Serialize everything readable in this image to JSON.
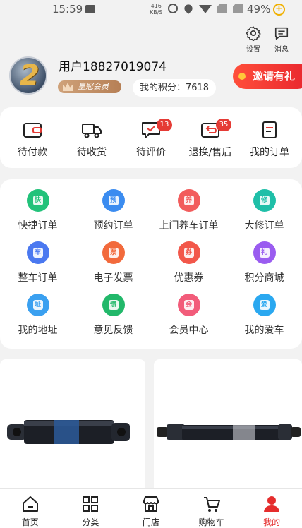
{
  "status_bar": {
    "time": "15:59",
    "speed_value": "416",
    "speed_unit": "KB/S",
    "battery": "49%"
  },
  "header": {
    "settings_label": "设置",
    "messages_label": "消息",
    "avatar_level": "2",
    "username": "用户18827019074",
    "member_badge": "皇冠会员",
    "points": "我的积分：7618",
    "invite_label": "邀请有礼"
  },
  "orders": {
    "items": [
      {
        "label": "待付款",
        "icon": "wallet-icon"
      },
      {
        "label": "待收货",
        "icon": "truck-icon"
      },
      {
        "label": "待评价",
        "icon": "review-icon",
        "count": "13"
      },
      {
        "label": "退换/售后",
        "icon": "return-icon",
        "count": "35"
      },
      {
        "label": "我的订单",
        "icon": "order-list-icon"
      }
    ]
  },
  "services": {
    "items": [
      {
        "label": "快捷订单",
        "glyph": "快",
        "color": "#22c27a"
      },
      {
        "label": "预约订单",
        "glyph": "预",
        "color": "#3b8cf0"
      },
      {
        "label": "上门养车订单",
        "glyph": "养",
        "color": "#f25c5c"
      },
      {
        "label": "大修订单",
        "glyph": "修",
        "color": "#1fbfa8"
      },
      {
        "label": "整车订单",
        "glyph": "车",
        "color": "#4a78f0"
      },
      {
        "label": "电子发票",
        "glyph": "票",
        "color": "#f26a3c"
      },
      {
        "label": "优惠券",
        "glyph": "券",
        "color": "#f2574a"
      },
      {
        "label": "积分商城",
        "glyph": "礼",
        "color": "#9a5cf0"
      },
      {
        "label": "我的地址",
        "glyph": "址",
        "color": "#3aa0f0"
      },
      {
        "label": "意见反馈",
        "glyph": "馈",
        "color": "#22b86a"
      },
      {
        "label": "会员中心",
        "glyph": "会",
        "color": "#f25c7a"
      },
      {
        "label": "我的爱车",
        "glyph": "爱",
        "color": "#2aa8f0"
      }
    ]
  },
  "tabbar": {
    "items": [
      {
        "label": "首页",
        "icon": "home-icon"
      },
      {
        "label": "分类",
        "icon": "category-icon"
      },
      {
        "label": "门店",
        "icon": "store-icon"
      },
      {
        "label": "购物车",
        "icon": "cart-icon"
      },
      {
        "label": "我的",
        "icon": "profile-icon"
      }
    ],
    "active": "我的",
    "active_color": "#e52d2d"
  },
  "colors": {
    "accent_red": "#e53b35",
    "badge_gold": "#b67f55"
  }
}
